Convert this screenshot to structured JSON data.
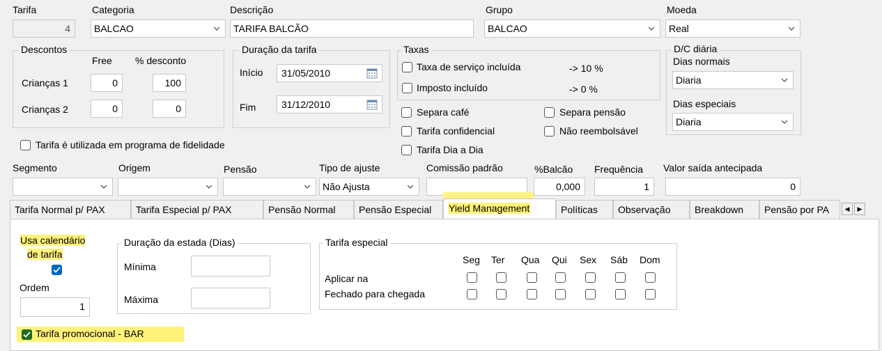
{
  "header": {
    "tarifa_label": "Tarifa",
    "tarifa_value": "4",
    "categoria_label": "Categoria",
    "categoria_value": "BALCAO",
    "descricao_label": "Descrição",
    "descricao_value": "TARIFA BALCÃO",
    "grupo_label": "Grupo",
    "grupo_value": "BALCAO",
    "moeda_label": "Moeda",
    "moeda_value": "Real"
  },
  "descontos": {
    "title": "Descontos",
    "free_label": "Free",
    "pct_label": "% desconto",
    "rows": [
      {
        "label": "Crianças 1",
        "free": "0",
        "pct": "100"
      },
      {
        "label": "Crianças 2",
        "free": "0",
        "pct": "0"
      }
    ]
  },
  "duracao": {
    "title": "Duração da tarifa",
    "inicio_label": "Início",
    "inicio_value": "31/05/2010",
    "fim_label": "Fim",
    "fim_value": "31/12/2010"
  },
  "taxas": {
    "title": "Taxas",
    "servico_label": "Taxa de serviço incluída",
    "servico_pct": "-> 10 %",
    "imposto_label": "Imposto incluído",
    "imposto_pct": "-> 0 %"
  },
  "checks": {
    "separa_cafe": "Separa café",
    "separa_pensao": "Separa pensão",
    "tarifa_confidencial": "Tarifa confidencial",
    "nao_reembolsavel": "Não reembolsável",
    "tarifa_dia_a_dia": "Tarifa Dia a Dia",
    "fidelidade": "Tarifa é utilizada em programa de fidelidade"
  },
  "dc": {
    "title": "D/C diária",
    "normais_label": "Dias normais",
    "normais_value": "Diaria",
    "especiais_label": "Dias especiais",
    "especiais_value": "Diaria"
  },
  "row2": {
    "segmento_label": "Segmento",
    "segmento_value": "",
    "origem_label": "Origem",
    "origem_value": "",
    "pensao_label": "Pensão",
    "pensao_value": "",
    "ajuste_label": "Tipo de ajuste",
    "ajuste_value": "Não Ajusta",
    "comissao_label": "Comissão padrão",
    "comissao_value": "",
    "balcao_label": "%Balcão",
    "balcao_value": "0,000",
    "frequencia_label": "Frequência",
    "frequencia_value": "1",
    "saida_label": "Valor saída antecipada",
    "saida_value": "0"
  },
  "tabs": [
    {
      "label": "Tarifa Normal p/ PAX"
    },
    {
      "label": "Tarifa Especial p/ PAX"
    },
    {
      "label": "Pensão Normal"
    },
    {
      "label": "Pensão Especial"
    },
    {
      "label": "Yield Management",
      "active": true
    },
    {
      "label": "Políticas"
    },
    {
      "label": "Observação"
    },
    {
      "label": "Breakdown"
    },
    {
      "label": "Pensão por PA"
    }
  ],
  "yield": {
    "usa_cal_line1": "Usa calendário",
    "usa_cal_line2": "de tarifa",
    "ordem_label": "Ordem",
    "ordem_value": "1",
    "estada_title": "Duração da estada (Dias)",
    "minima_label": "Mínima",
    "minima_value": "",
    "maxima_label": "Máxima",
    "maxima_value": "",
    "especial_title": "Tarifa especial",
    "days": [
      "Seg",
      "Ter",
      "Qua",
      "Qui",
      "Sex",
      "Sáb",
      "Dom"
    ],
    "aplicar_label": "Aplicar na",
    "fechado_label": "Fechado para chegada",
    "promo_label": "Tarifa promocional - BAR"
  },
  "colors": {
    "highlight": "#fff200",
    "check_blue": "#0067c0"
  }
}
